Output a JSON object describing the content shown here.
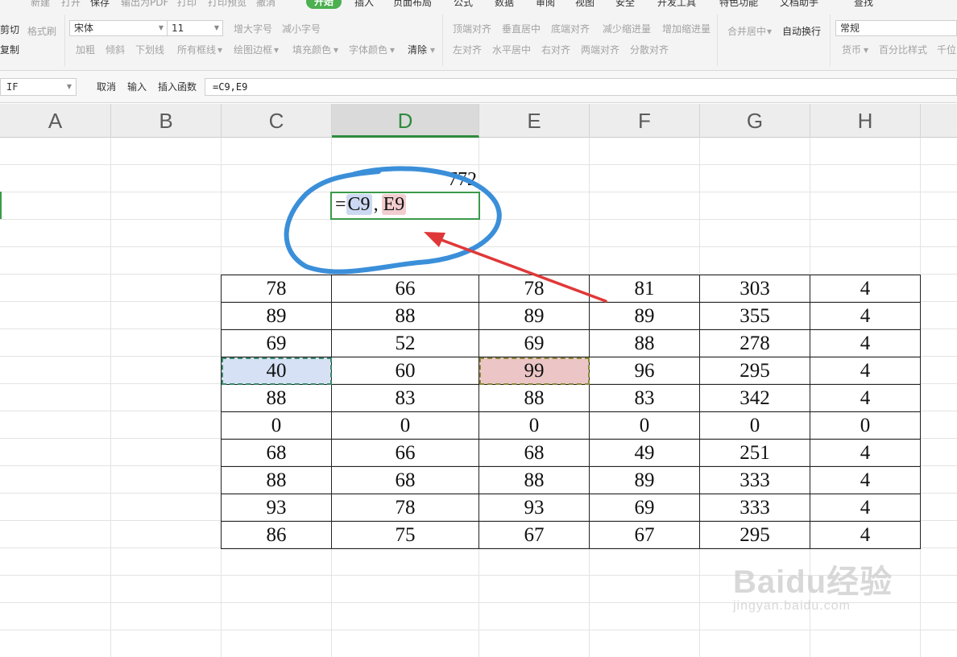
{
  "tabs": [
    {
      "label": "新建"
    },
    {
      "label": "打开"
    },
    {
      "label": "保存"
    },
    {
      "label": "输出为PDF"
    },
    {
      "label": "打印"
    },
    {
      "label": "打印预览"
    },
    {
      "label": "撤消"
    },
    {
      "label": "开始"
    },
    {
      "label": "插入"
    },
    {
      "label": "页面布局"
    },
    {
      "label": "公式"
    },
    {
      "label": "数据"
    },
    {
      "label": "审阅"
    },
    {
      "label": "视图"
    },
    {
      "label": "安全"
    },
    {
      "label": "开发工具"
    },
    {
      "label": "特色功能"
    },
    {
      "label": "文档助手"
    },
    {
      "label": "查找"
    }
  ],
  "ribbon": {
    "cut": "剪切",
    "format_painter": "格式刷",
    "copy": "复制",
    "font_name": "宋体",
    "font_size": "11",
    "increase_font": "增大字号",
    "decrease_font": "减小字号",
    "bold": "加粗",
    "italic": "倾斜",
    "underline": "下划线",
    "all_borders": "所有框线",
    "draw_border": "绘图边框",
    "fill_color": "填充颜色",
    "font_color": "字体颜色",
    "clear": "清除",
    "top_align": "顶端对齐",
    "middle_align": "垂直居中",
    "bottom_align": "底端对齐",
    "decrease_indent": "减少缩进量",
    "increase_indent": "增加缩进量",
    "merge_center": "合并居中",
    "wrap_text": "自动换行",
    "left_align": "左对齐",
    "center_align": "水平居中",
    "right_align": "右对齐",
    "justify": "两端对齐",
    "distribute": "分散对齐",
    "number_format": "常规",
    "currency": "货币",
    "percent": "百分比样式",
    "thousands": "千位"
  },
  "formula_bar": {
    "name_box": "IF",
    "cancel": "取消",
    "enter": "输入",
    "insert_function": "插入函数",
    "formula": "=C9,E9"
  },
  "columns": [
    "A",
    "B",
    "C",
    "D",
    "E",
    "F",
    "G",
    "H"
  ],
  "cells": {
    "d7_value": "772",
    "edit_prefix": "=",
    "edit_ref1": "C9",
    "edit_sep": ",",
    "edit_ref2": "E9"
  },
  "table": [
    [
      "78",
      "66",
      "78",
      "81",
      "303",
      "4"
    ],
    [
      "89",
      "88",
      "89",
      "89",
      "355",
      "4"
    ],
    [
      "69",
      "52",
      "69",
      "88",
      "278",
      "4"
    ],
    [
      "40",
      "60",
      "99",
      "96",
      "295",
      "4"
    ],
    [
      "88",
      "83",
      "88",
      "83",
      "342",
      "4"
    ],
    [
      "0",
      "0",
      "0",
      "0",
      "0",
      "0"
    ],
    [
      "68",
      "66",
      "68",
      "49",
      "251",
      "4"
    ],
    [
      "88",
      "68",
      "88",
      "89",
      "333",
      "4"
    ],
    [
      "93",
      "78",
      "93",
      "69",
      "333",
      "4"
    ],
    [
      "86",
      "75",
      "67",
      "67",
      "295",
      "4"
    ]
  ],
  "watermark": {
    "brand": "Baidu经验",
    "url": "jingyan.baidu.com"
  },
  "colors": {
    "accent_green": "#4caf50",
    "annotation_blue": "#3b8fd9",
    "arrow_red": "#e03838",
    "ref1_fill": "#cdd9f2",
    "ref2_fill": "#f2cdd0"
  }
}
